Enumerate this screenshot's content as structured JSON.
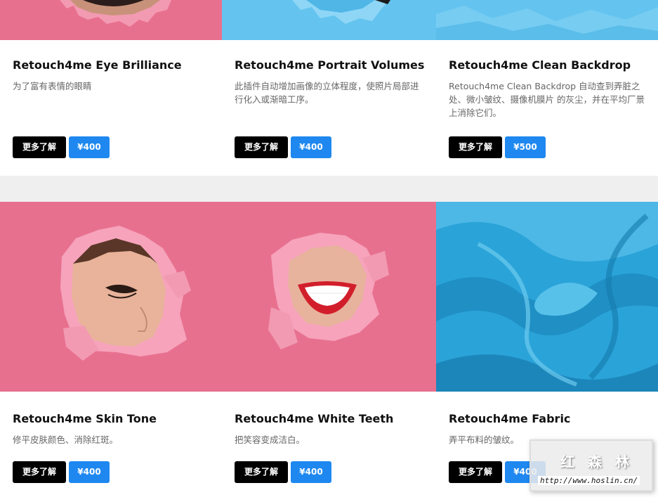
{
  "colors": {
    "accent": "#1e88f0",
    "learn_button": "#000000",
    "pink_backdrop": "#e8708f",
    "blue_backdrop": "#64c4ef",
    "fabric_blue": "#2aa3d8",
    "section_gap": "#efefef"
  },
  "products_top": [
    {
      "title": "Retouch4me Eye Brilliance",
      "description": "为了富有表情的眼睛",
      "learn_label": "更多了解",
      "price": "¥400",
      "image": "pink-torn-paper-photo"
    },
    {
      "title": "Retouch4me Portrait Volumes",
      "description": "此插件自动增加画像的立体程度，使照片局部进行化入或渐暗工序。",
      "learn_label": "更多了解",
      "price": "¥400",
      "image": "blue-torn-paper-photo"
    },
    {
      "title": "Retouch4me Clean Backdrop",
      "description": "Retouch4me Clean Backdrop 自动查到弄脏之处、微小皱纹、摄像机膜片 的灰尘，并在平均厂景上消除它们。",
      "learn_label": "更多了解",
      "price": "¥500",
      "image": "blue-crumpled-backdrop-photo"
    }
  ],
  "products_bottom": [
    {
      "title": "Retouch4me Skin Tone",
      "description": "修平皮肤颜色、消除红斑。",
      "learn_label": "更多了解",
      "price": "¥400",
      "image": "woman-face-through-pink-paper-photo"
    },
    {
      "title": "Retouch4me White Teeth",
      "description": "把笑容变成洁白。",
      "learn_label": "更多了解",
      "price": "¥400",
      "image": "smile-through-pink-paper-photo"
    },
    {
      "title": "Retouch4me Fabric",
      "description": "弄平布料的皱纹。",
      "learn_label": "更多了解",
      "price": "¥400",
      "image": "blue-silk-fabric-photo"
    }
  ],
  "watermark": {
    "logo_text": "红 森 林",
    "url": "http://www.hoslin.cn/"
  }
}
